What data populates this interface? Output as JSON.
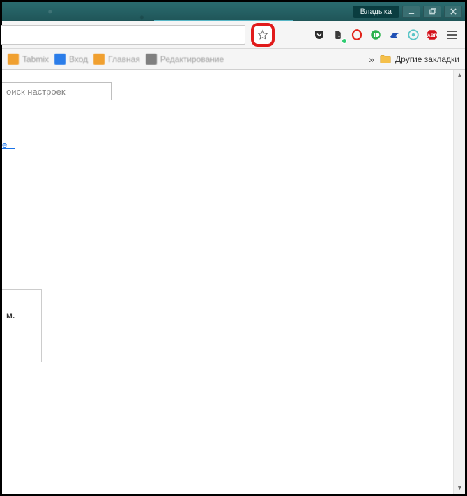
{
  "window": {
    "user_label": "Владыка"
  },
  "bookbar": {
    "items": [
      {
        "label": "Tabmix",
        "color": "#f0a030"
      },
      {
        "label": "Вход",
        "color": "#2b7de9"
      },
      {
        "label": "Главная",
        "color": "#f0a030"
      },
      {
        "label": "Редактирование",
        "color": "#808080"
      }
    ],
    "overflow": "»",
    "folder_label": "Другие закладки"
  },
  "content": {
    "search_placeholder": "оиск настроек",
    "link_fragment": "е",
    "card_fragment": "м."
  },
  "ext_icons": [
    "pocket-icon",
    "evernote-icon",
    "opera-icon",
    "pushbullet-icon",
    "dolphin-icon",
    "avast-icon",
    "adblock-icon"
  ]
}
